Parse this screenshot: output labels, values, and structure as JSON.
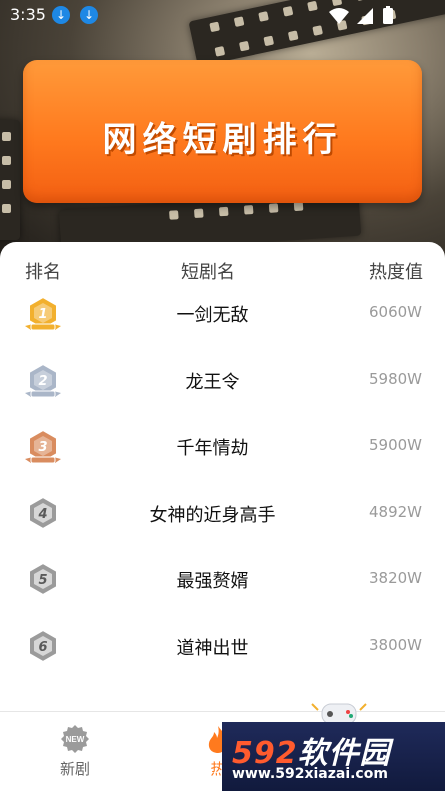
{
  "status_bar": {
    "time": "3:35"
  },
  "banner": {
    "title": "网络短剧排行"
  },
  "table": {
    "headers": {
      "rank": "排名",
      "name": "短剧名",
      "heat": "热度值"
    },
    "rows": [
      {
        "rank": "1",
        "name": "一剑无敌",
        "heat": "6060W",
        "tier": "gold"
      },
      {
        "rank": "2",
        "name": "龙王令",
        "heat": "5980W",
        "tier": "silver"
      },
      {
        "rank": "3",
        "name": "千年情劫",
        "heat": "5900W",
        "tier": "bronze"
      },
      {
        "rank": "4",
        "name": "女神的近身高手",
        "heat": "4892W",
        "tier": "plain"
      },
      {
        "rank": "5",
        "name": "最强赘婿",
        "heat": "3820W",
        "tier": "plain"
      },
      {
        "rank": "6",
        "name": "道神出世",
        "heat": "3800W",
        "tier": "plain"
      }
    ]
  },
  "bottom_nav": {
    "items": [
      {
        "label": "新剧",
        "badge": "NEW"
      },
      {
        "label": "热"
      }
    ]
  },
  "watermark": {
    "brand_num": "592",
    "brand_text": "软件园",
    "url": "www.592xiazai.com"
  },
  "colors": {
    "accent": "#ff7a1e",
    "gold": "#f2b02e",
    "silver": "#aab6c8",
    "bronze": "#d98c5f",
    "plain": "#9b9b9b"
  }
}
